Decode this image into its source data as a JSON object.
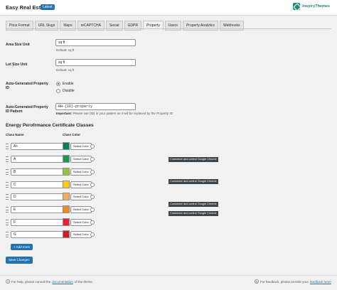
{
  "header": {
    "title": "Easy Real Estate",
    "badge": "Latest",
    "brand": "InspiryThemes"
  },
  "tabs": [
    {
      "label": "Price Format"
    },
    {
      "label": "URL Slugs"
    },
    {
      "label": "Maps"
    },
    {
      "label": "reCAPTCHA"
    },
    {
      "label": "Social"
    },
    {
      "label": "GDPR"
    },
    {
      "label": "Property"
    },
    {
      "label": "Users"
    },
    {
      "label": "Property Analytics"
    },
    {
      "label": "Webhooks"
    }
  ],
  "active_tab": "Property",
  "fields": {
    "area_label": "Area Size Unit",
    "area_value": "sq ft",
    "area_help": "Default: sq ft",
    "lot_label": "Lot Size Unit",
    "lot_value": "sq ft",
    "lot_help": "Default: sq ft",
    "autoid_label": "Auto-Generated Property ID",
    "autoid_enable": "Enable",
    "autoid_disable": "Disable",
    "pattern_label": "Auto-Generated Property ID Pattern",
    "pattern_value": "RH-{ID}-property",
    "pattern_help_strong": "Important:",
    "pattern_help": "Please use {ID} in your pattern as it will be replaced by the Property ID."
  },
  "energy": {
    "title": "Energy Perofrmance Certificate Classes",
    "col_name": "Class Name",
    "col_color": "Class Color",
    "select_label": "Select Color",
    "classes": [
      {
        "name": "A+",
        "color": "#00845a"
      },
      {
        "name": "A",
        "color": "#1a9a4a"
      },
      {
        "name": "B",
        "color": "#8dc63f"
      },
      {
        "name": "C",
        "color": "#ffcc00"
      },
      {
        "name": "D",
        "color": "#f3a965"
      },
      {
        "name": "E",
        "color": "#f18a22"
      },
      {
        "name": "F",
        "color": "#ee1c2d"
      },
      {
        "name": "G",
        "color": "#d01f1e"
      }
    ],
    "tooltip": "Customize and control Google Chrome",
    "add_more": "+ Add more"
  },
  "save_label": "Save Changes",
  "footer": {
    "left_pre": "For help, please consult the",
    "left_link": "documentation",
    "left_post": "of the theme.",
    "right_pre": "For feedback, please provide your",
    "right_link": "feedback here!"
  }
}
